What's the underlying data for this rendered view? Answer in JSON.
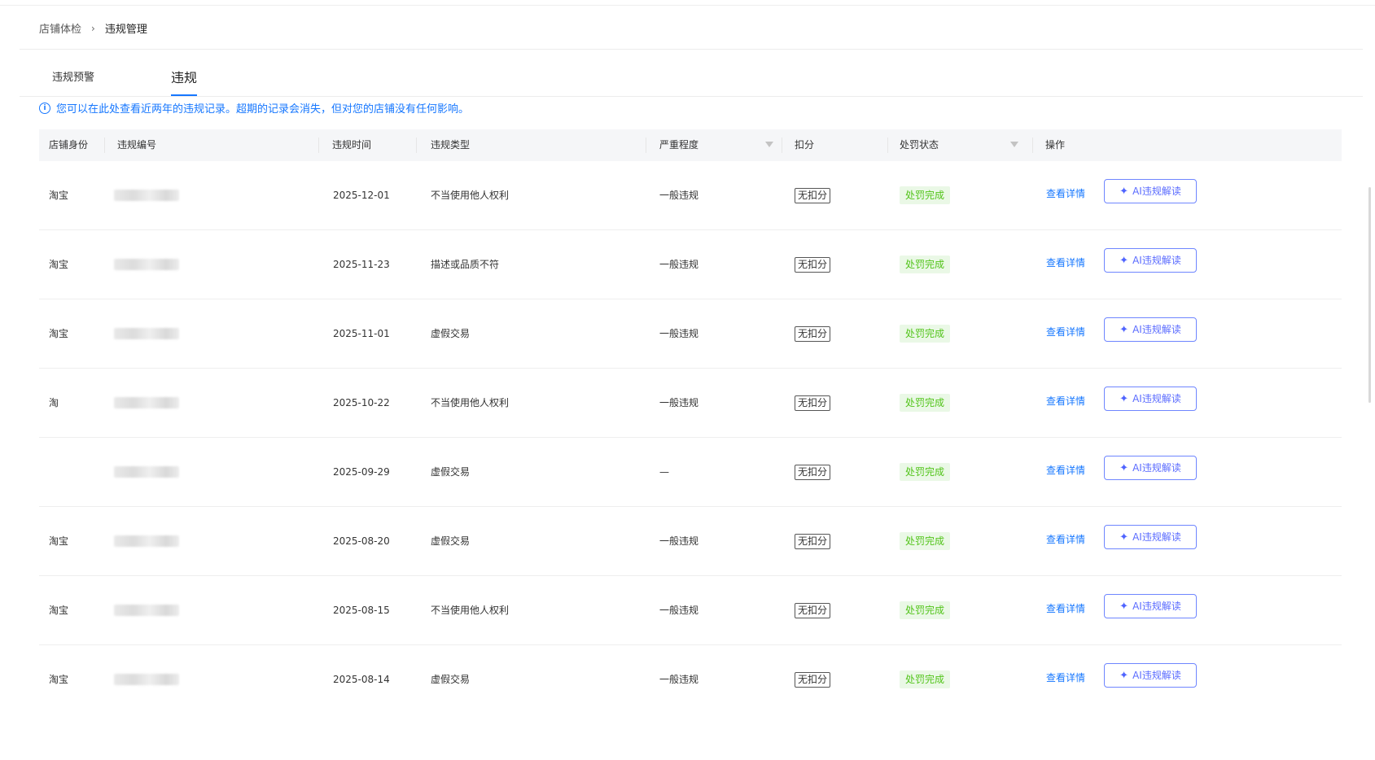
{
  "breadcrumb": {
    "parent": "店铺体检",
    "separator": "›",
    "current": "违规管理"
  },
  "tabs": {
    "warning": "违规预警",
    "violation": "违规"
  },
  "notice": {
    "icon": "info-icon",
    "text": "您可以在此处查看近两年的违规记录。超期的记录会消失，但对您的店铺没有任何影响。"
  },
  "table": {
    "headers": {
      "shop_identity": "店铺身份",
      "violation_no": "违规编号",
      "violation_time": "违规时间",
      "violation_type": "违规类型",
      "severity": "严重程度",
      "deduction": "扣分",
      "penalty_status": "处罚状态",
      "actions": "操作"
    },
    "rows": [
      {
        "shop": "淘宝",
        "date": "2025-12-01",
        "type": "不当使用他人权利",
        "severity": "一般违规",
        "deduction": "无扣分",
        "status": "处罚完成",
        "detail": "查看详情",
        "ai": "AI违规解读"
      },
      {
        "shop": "淘宝",
        "date": "2025-11-23",
        "type": "描述或品质不符",
        "severity": "一般违规",
        "deduction": "无扣分",
        "status": "处罚完成",
        "detail": "查看详情",
        "ai": "AI违规解读"
      },
      {
        "shop": "淘宝",
        "date": "2025-11-01",
        "type": "虚假交易",
        "severity": "一般违规",
        "deduction": "无扣分",
        "status": "处罚完成",
        "detail": "查看详情",
        "ai": "AI违规解读"
      },
      {
        "shop": "淘",
        "date": "2025-10-22",
        "type": "不当使用他人权利",
        "severity": "一般违规",
        "deduction": "无扣分",
        "status": "处罚完成",
        "detail": "查看详情",
        "ai": "AI违规解读"
      },
      {
        "shop": "",
        "date": "2025-09-29",
        "type": "虚假交易",
        "severity": "—",
        "deduction": "无扣分",
        "status": "处罚完成",
        "detail": "查看详情",
        "ai": "AI违规解读"
      },
      {
        "shop": "淘宝",
        "date": "2025-08-20",
        "type": "虚假交易",
        "severity": "一般违规",
        "deduction": "无扣分",
        "status": "处罚完成",
        "detail": "查看详情",
        "ai": "AI违规解读"
      },
      {
        "shop": "淘宝",
        "date": "2025-08-15",
        "type": "不当使用他人权利",
        "severity": "一般违规",
        "deduction": "无扣分",
        "status": "处罚完成",
        "detail": "查看详情",
        "ai": "AI违规解读"
      },
      {
        "shop": "淘宝",
        "date": "2025-08-14",
        "type": "虚假交易",
        "severity": "一般违规",
        "deduction": "无扣分",
        "status": "处罚完成",
        "detail": "查看详情",
        "ai": "AI违规解读"
      }
    ]
  },
  "colors": {
    "accent": "#1677ff",
    "status_green": "#52c41a",
    "status_green_bg": "#eaf8e6",
    "ai_purple": "#5b6cff"
  }
}
